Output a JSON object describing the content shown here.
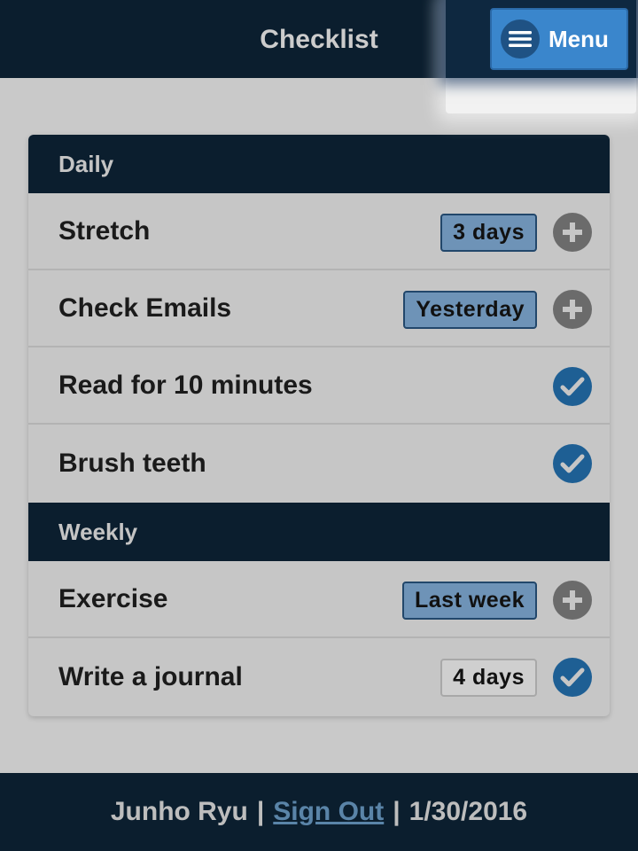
{
  "header": {
    "title": "Checklist"
  },
  "menu": {
    "label": "Menu",
    "icon": "hamburger-icon"
  },
  "sections": [
    {
      "title": "Daily",
      "items": [
        {
          "title": "Stretch",
          "badge": "3 days",
          "badge_style": "blue",
          "action": "add",
          "action_icon": "plus-icon"
        },
        {
          "title": "Check Emails",
          "badge": "Yesterday",
          "badge_style": "blue",
          "action": "add",
          "action_icon": "plus-icon"
        },
        {
          "title": "Read for 10 minutes",
          "badge": null,
          "action": "done",
          "action_icon": "check-icon"
        },
        {
          "title": "Brush teeth",
          "badge": null,
          "action": "done",
          "action_icon": "check-icon"
        }
      ]
    },
    {
      "title": "Weekly",
      "items": [
        {
          "title": "Exercise",
          "badge": "Last week",
          "badge_style": "blue",
          "action": "add",
          "action_icon": "plus-icon"
        },
        {
          "title": "Write a journal",
          "badge": "4 days",
          "badge_style": "gray",
          "action": "done",
          "action_icon": "check-icon"
        }
      ]
    }
  ],
  "footer": {
    "user_name": "Junho Ryu",
    "separator": "|",
    "sign_out_label": "Sign Out",
    "date": "1/30/2016"
  },
  "colors": {
    "header_bg": "#0b1e2e",
    "page_bg": "#c9c9c9",
    "badge_blue": "#6e93b7",
    "check_blue": "#1e5f94",
    "add_gray": "#6b6b6b",
    "menu_button": "#3a86cc",
    "link": "#5a84a8"
  }
}
